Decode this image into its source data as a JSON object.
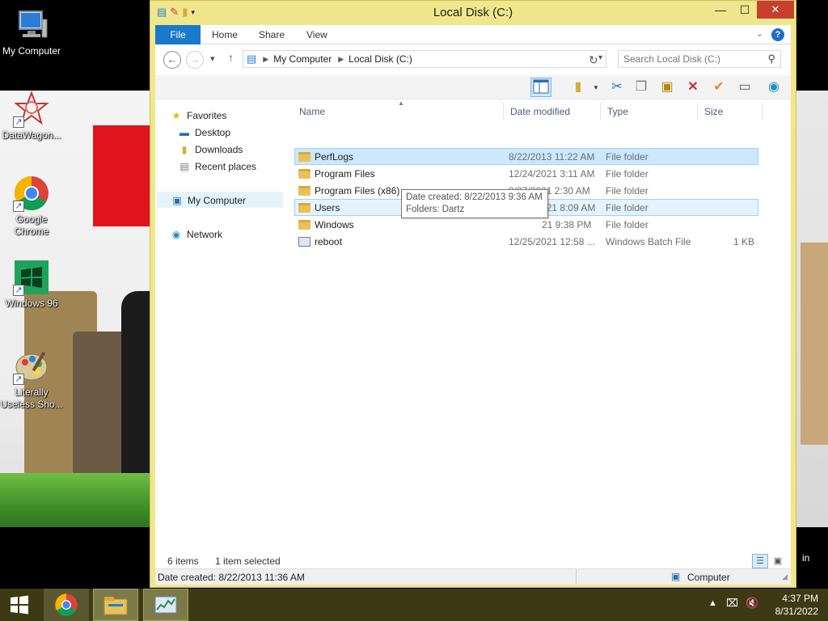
{
  "desktop": {
    "icons": [
      {
        "label": "My Computer"
      },
      {
        "label": "DataWagon..."
      },
      {
        "label": "Google Chrome"
      },
      {
        "label": "Windows 96"
      },
      {
        "label": "Literally Useless Sho..."
      }
    ],
    "edge_text": "in"
  },
  "window": {
    "title": "Local Disk (C:)",
    "controls": {
      "minimize": "—",
      "maximize": "☐",
      "close": "✕"
    }
  },
  "ribbon": {
    "tabs": [
      "File",
      "Home",
      "Share",
      "View"
    ],
    "help": "?"
  },
  "address": {
    "crumbs": [
      "My Computer",
      "Local Disk (C:)"
    ],
    "search_placeholder": "Search Local Disk (C:)"
  },
  "nav_pane": {
    "favorites": "Favorites",
    "desktop": "Desktop",
    "downloads": "Downloads",
    "recent": "Recent places",
    "my_computer": "My Computer",
    "network": "Network"
  },
  "columns": {
    "name": "Name",
    "date": "Date modified",
    "type": "Type",
    "size": "Size"
  },
  "files": [
    {
      "name": "PerfLogs",
      "date": "8/22/2013 11:22 AM",
      "type": "File folder",
      "size": ""
    },
    {
      "name": "Program Files",
      "date": "12/24/2021 3:11 AM",
      "type": "File folder",
      "size": ""
    },
    {
      "name": "Program Files (x86)",
      "date": "8/27/2021 2:30 AM",
      "type": "File folder",
      "size": ""
    },
    {
      "name": "Users",
      "date": "12/24/2021 8:09 AM",
      "type": "File folder",
      "size": ""
    },
    {
      "name": "Windows",
      "date": "21 9:38 PM",
      "type": "File folder",
      "size": ""
    },
    {
      "name": "reboot",
      "date": "12/25/2021 12:58 ...",
      "type": "Windows Batch File",
      "size": "1 KB"
    }
  ],
  "tooltip": {
    "line1": "Date created: 8/22/2013 9:36 AM",
    "line2": "Folders: Dartz"
  },
  "status": {
    "items": "6 items",
    "selected": "1 item selected"
  },
  "details_bar": {
    "left": "Date created: 8/22/2013 11:36 AM",
    "right": "Computer"
  },
  "taskbar": {
    "time": "4:37 PM",
    "date": "8/31/2022"
  },
  "colors": {
    "window_frame": "#f0e68c",
    "accent": "#1979ca",
    "selection": "#cce8ff",
    "taskbar": "#3d3a13"
  }
}
